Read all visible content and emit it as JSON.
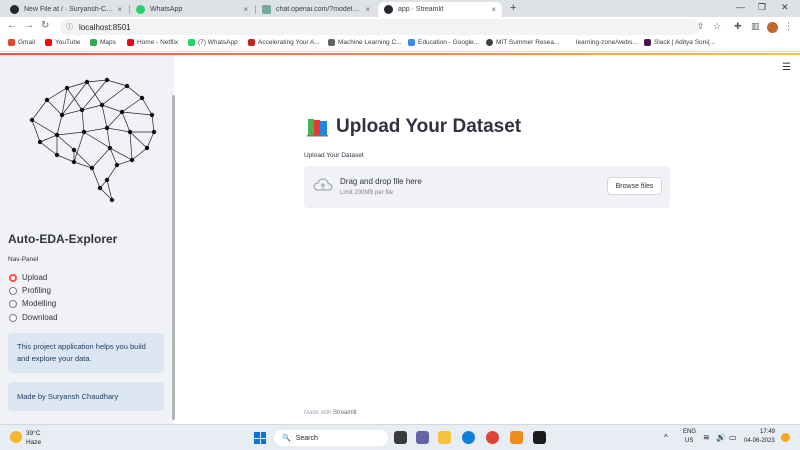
{
  "browser": {
    "tabs": [
      {
        "title": "New File at / · Suryansh-Codes2...",
        "favicon_color": "#24292f"
      },
      {
        "title": "WhatsApp",
        "favicon_color": "#25d366"
      },
      {
        "title": "chat.openai.com/?model=text-d...",
        "favicon_color": "#74aa9c"
      },
      {
        "title": "app · Streamlit",
        "favicon_color": "#262730"
      }
    ],
    "tab_close_glyph": "×",
    "new_tab_glyph": "+",
    "url": "localhost:8501",
    "bookmarks": [
      {
        "label": "Gmail",
        "color": "#ea4335"
      },
      {
        "label": "YouTube",
        "color": "#ff0000"
      },
      {
        "label": "Maps",
        "color": "#34a853"
      },
      {
        "label": "Home - Netflix",
        "color": "#e50914"
      },
      {
        "label": "(7) WhatsApp",
        "color": "#25d366"
      },
      {
        "label": "Accelerating Your A...",
        "color": "#c5221f"
      },
      {
        "label": "Machine Learning C...",
        "color": "#5f6368"
      },
      {
        "label": "Education - Google...",
        "color": "#4285f4"
      },
      {
        "label": "MIT Summer Resea...",
        "color": "#3c4043"
      },
      {
        "label": "learning-zone/webs...",
        "color": "#ffffff"
      },
      {
        "label": "Slack | Aditya Soni(...",
        "color": "#4a154b"
      }
    ]
  },
  "sidebar": {
    "title": "Auto-EDA-Explorer",
    "nav_label": "Nav-Panel",
    "nav_options": [
      "Upload",
      "Profiling",
      "Modelling",
      "Download"
    ],
    "selected_option": "Upload",
    "info_text": "This project application helps you build and explore your data.",
    "made_by": "Made by Suryansh Chaudhary"
  },
  "main": {
    "title": "Upload Your Dataset",
    "uploader_label": "Upload Your Dataset",
    "drop_text": "Drag and drop file here",
    "limit_text": "Limit 200MB per file",
    "browse_label": "Browse files",
    "footer_prefix": "Made with",
    "footer_brand": "Streamlit"
  },
  "taskbar": {
    "weather_temp": "39°C",
    "weather_cond": "Haze",
    "search_label": "Search",
    "lang_primary": "ENG",
    "lang_region": "US",
    "time": "17:49",
    "date": "04-06-2023"
  },
  "colors": {
    "accent": "#ff4b4b",
    "sidebar_bg": "#f0f2f6",
    "info_bg": "#dbe6f2"
  }
}
